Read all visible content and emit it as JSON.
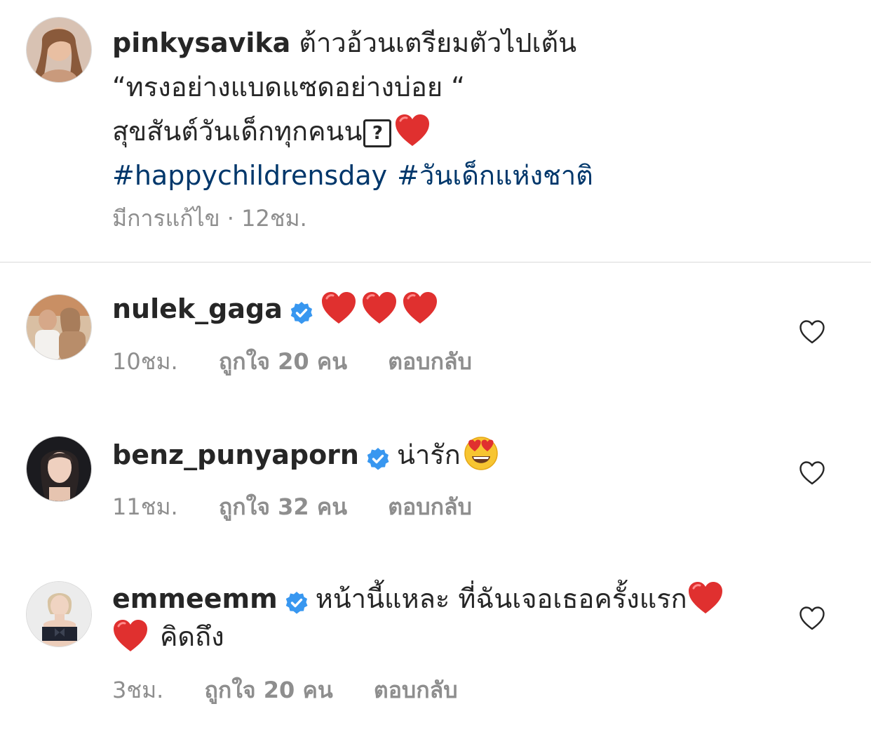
{
  "caption": {
    "username": "pinkysavika",
    "line1": "ต้าวอ้วนเตรียมตัวไปเต้น",
    "line2": "“ทรงอย่างแบดแซดอย่างบ่อย “",
    "line3": "สุขสันต์วันเด็กทุกคนน",
    "unknown_glyph": "?",
    "hashtags": [
      "#happychildrensday",
      "#วันเด็กแห่งชาติ"
    ],
    "meta": "มีการแก้ไข · 12ชม."
  },
  "comments": [
    {
      "username": "nulek_gaga",
      "verified": true,
      "text": "",
      "time": "10ชม.",
      "likes": "ถูกใจ 20 คน",
      "reply": "ตอบกลับ"
    },
    {
      "username": "benz_punyaporn",
      "verified": true,
      "text": "น่ารัก",
      "time": "11ชม.",
      "likes": "ถูกใจ 32 คน",
      "reply": "ตอบกลับ"
    },
    {
      "username": "emmeemm",
      "verified": true,
      "text": "หน้านี้แหละ ที่ฉันเจอเธอครั้งแรก",
      "text2": "คิดถึง",
      "time": "3ชม.",
      "likes": "ถูกใจ 20 คน",
      "reply": "ตอบกลับ"
    }
  ],
  "colors": {
    "text": "#262626",
    "secondary": "#8e8e8e",
    "hashtag": "#00376b",
    "verified": "#3897f0",
    "heart": "#e0302f",
    "divider": "#dbdbdb"
  },
  "icons": {
    "verified": "verified-badge-icon",
    "like": "heart-outline-icon",
    "heart_emoji": "red-heart-emoji",
    "smile_emoji": "heart-eyes-emoji"
  }
}
